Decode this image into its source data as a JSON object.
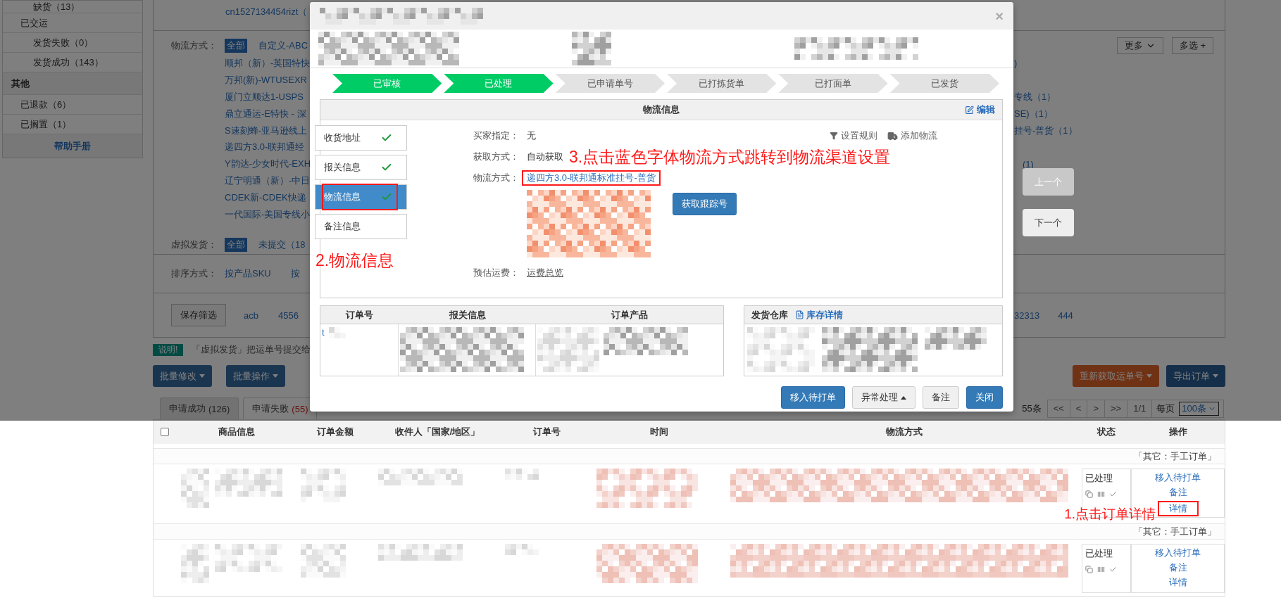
{
  "sidebar": {
    "items": [
      {
        "label": "缺货（13）",
        "kind": "sub"
      },
      {
        "label": "已交运",
        "kind": "item"
      },
      {
        "label": "发货失败（0）",
        "kind": "sub"
      },
      {
        "label": "发货成功（143）",
        "kind": "sub"
      },
      {
        "label": "其他",
        "kind": "header"
      },
      {
        "label": "已退款（6）",
        "kind": "item"
      },
      {
        "label": "已搁置（1）",
        "kind": "item"
      }
    ],
    "help_link": "帮助手册"
  },
  "filters": {
    "top_text": "cn1527134454rizt（",
    "logistics": {
      "label": "物流方式：",
      "more_button": "更多",
      "multi_button": "多选 +",
      "lines": [
        {
          "options": [
            {
              "label": "全部",
              "selected": true
            },
            {
              "label": "自定义-ABC",
              "selected": false
            }
          ]
        },
        {
          "options": [
            {
              "label": "顺邦（新）-英国特快",
              "selected": false
            }
          ],
          "right": ")"
        },
        {
          "options": [
            {
              "label": "万邦(新)-WTUSEXR",
              "selected": false
            }
          ]
        },
        {
          "options": [
            {
              "label": "厦门立顺达1-USPS",
              "selected": false
            }
          ],
          "right": "专线（1）"
        },
        {
          "options": [
            {
              "label": "鼎立通运-E特快 - 深",
              "selected": false
            }
          ],
          "right": "SE)（1）"
        },
        {
          "options": [
            {
              "label": "S速刻蜂-亚马逊线上",
              "selected": false
            }
          ],
          "right": "挂号-普货（1）"
        },
        {
          "options": [
            {
              "label": "递四方3.0-联邦通经",
              "selected": false
            }
          ]
        },
        {
          "options": [
            {
              "label": "Y韵达-少女时代-EXH",
              "selected": false
            }
          ],
          "right": "(1)"
        },
        {
          "options": [
            {
              "label": "辽宁明通（新）-中日",
              "selected": false
            }
          ]
        },
        {
          "options": [
            {
              "label": "CDEK新-CDEK快递",
              "selected": false
            }
          ]
        },
        {
          "options": [
            {
              "label": "一代国际-美国专线小",
              "selected": false
            }
          ]
        }
      ]
    },
    "virtual": {
      "label": "虚拟发货：",
      "options": [
        {
          "label": "全部",
          "selected": true
        },
        {
          "label": "未提交（18",
          "selected": false
        }
      ]
    },
    "sort": {
      "label": "排序方式：",
      "options": [
        {
          "label": "按产品SKU",
          "selected": false
        },
        {
          "label": "按",
          "selected": false
        }
      ]
    },
    "saved": {
      "button": "保存筛选",
      "items": [
        "acb",
        "4556"
      ],
      "right_items": [
        "32313",
        "444"
      ]
    }
  },
  "notice": {
    "badge": "说明!",
    "text": "「虚拟发货」把运单号提交给"
  },
  "bulk_buttons": [
    "批量修改",
    "批量操作"
  ],
  "right_buttons": [
    {
      "label": "重新获取运单号",
      "kind": "warning"
    },
    {
      "label": "导出订单",
      "kind": "dark"
    }
  ],
  "tabs": [
    {
      "label": "申请成功",
      "count": "(126)",
      "kind": "normal",
      "selected": false
    },
    {
      "label": "申请失败",
      "count": "(55)",
      "kind": "danger",
      "selected": true
    }
  ],
  "pagination": {
    "total": "55条",
    "buttons": [
      "<<",
      "<",
      ">",
      ">>"
    ],
    "page": "1/1",
    "per_page_label": "每页",
    "per_page": "100条"
  },
  "table": {
    "select_all": {
      "checked": false
    },
    "columns": [
      "商品信息",
      "订单金额",
      "收件人「国家/地区」",
      "订单号",
      "时间",
      "物流方式",
      "状态",
      "操作"
    ],
    "groups": [
      {
        "label": "「其它：手工订单」",
        "status": "已处理",
        "annotation": "1.点击订单详情",
        "actions": [
          {
            "label": "移入待打单",
            "annotated": false
          },
          {
            "label": "备注",
            "annotated": false
          },
          {
            "label": "详情",
            "annotated": true
          }
        ]
      },
      {
        "label": "「其它：手工订单」",
        "status": "已处理",
        "actions": [
          {
            "label": "移入待打单",
            "annotated": false
          },
          {
            "label": "备注",
            "annotated": false
          },
          {
            "label": "详情",
            "annotated": false
          }
        ]
      }
    ]
  },
  "nav_buttons": [
    {
      "label": "上一个",
      "disabled": true
    },
    {
      "label": "下一个",
      "disabled": false
    }
  ],
  "modal": {
    "close": "×",
    "steps": [
      {
        "label": "已审核",
        "done": true
      },
      {
        "label": "已处理",
        "done": true
      },
      {
        "label": "已申请单号",
        "done": false
      },
      {
        "label": "已打拣货单",
        "done": false
      },
      {
        "label": "已打面单",
        "done": false
      },
      {
        "label": "已发货",
        "done": false
      }
    ],
    "panel": {
      "title": "物流信息",
      "edit": "编辑",
      "tools": [
        "设置规则",
        "添加物流"
      ],
      "tabs": [
        {
          "label": "收货地址",
          "checked": true,
          "selected": false,
          "annotated": false
        },
        {
          "label": "报关信息",
          "checked": true,
          "selected": false,
          "annotated": false
        },
        {
          "label": "物流信息",
          "checked": true,
          "selected": true,
          "annotated": true
        },
        {
          "label": "备注信息",
          "checked": false,
          "selected": false,
          "annotated": false
        }
      ],
      "fields": [
        {
          "label": "买家指定：",
          "value": "无",
          "kind": "text"
        },
        {
          "label": "获取方式：",
          "value": "自动获取",
          "kind": "text",
          "note": "3.点击蓝色字体物流方式跳转到物流渠道设置"
        },
        {
          "label": "物流方式：",
          "value": "递四方3.0-联邦通标准挂号-普货",
          "kind": "link",
          "annotated": true,
          "button": "获取跟踪号"
        },
        {
          "label": "预估运费：",
          "value": "运费总览",
          "kind": "underline"
        }
      ]
    },
    "tab_annotation": "2.物流信息",
    "order_table": {
      "columns": [
        "订单号",
        "报关信息",
        "订单产品"
      ],
      "first_cell": "t"
    },
    "warehouse": {
      "label": "发货仓库",
      "link": "库存详情"
    },
    "buttons": [
      {
        "label": "移入待打单",
        "kind": "primary"
      },
      {
        "label": "异常处理",
        "kind": "dropdown"
      },
      {
        "label": "备注",
        "kind": "default"
      },
      {
        "label": "关闭",
        "kind": "primary"
      }
    ]
  }
}
